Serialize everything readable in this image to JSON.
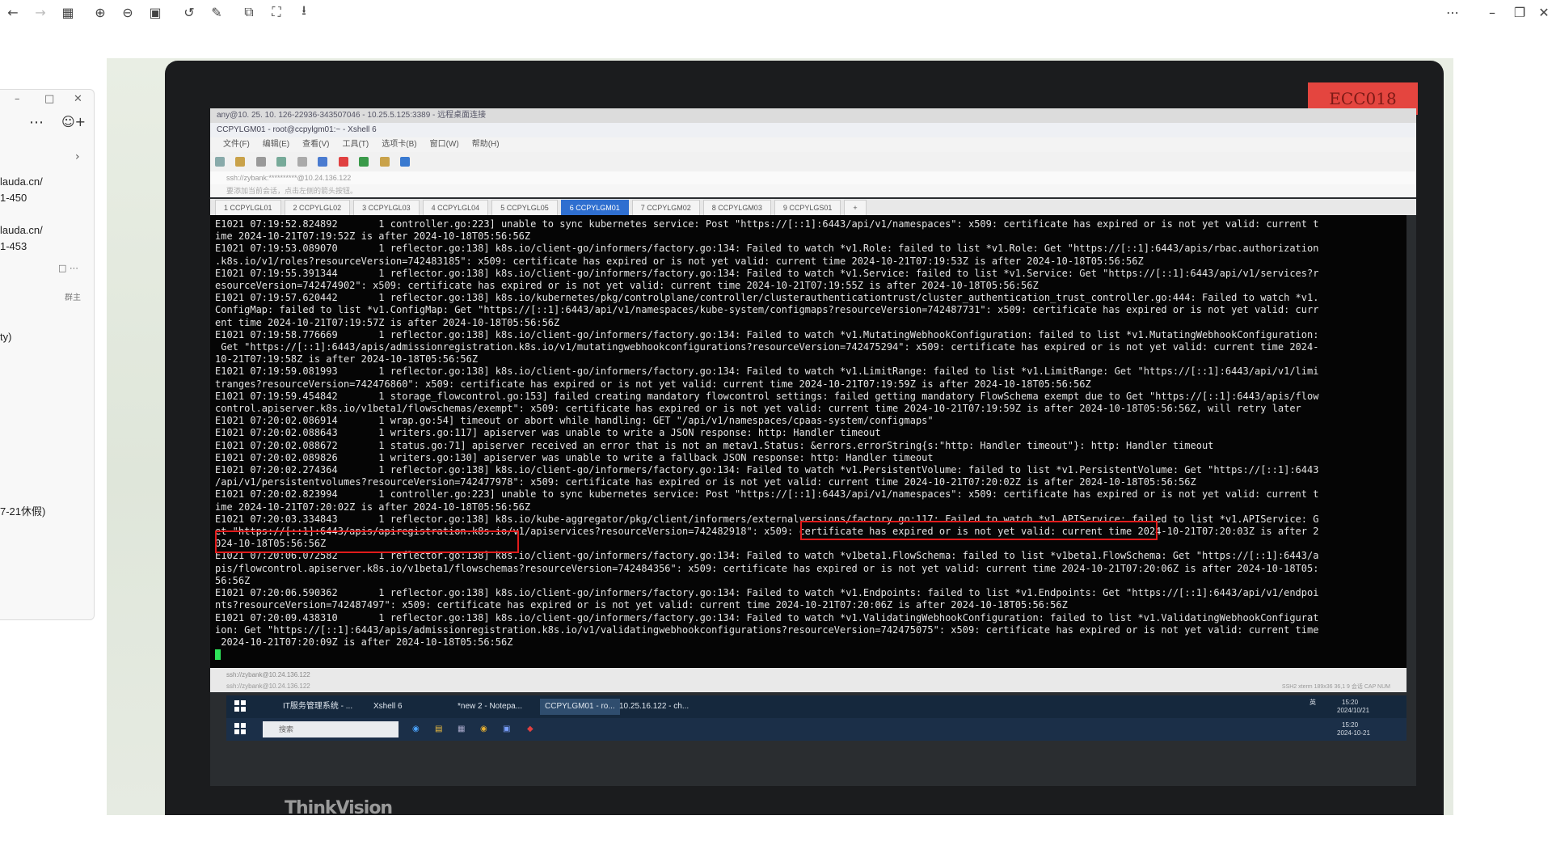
{
  "toolbar": {
    "icons": [
      "back-arrow",
      "forward-arrow",
      "grid",
      "zoom-in",
      "zoom-out",
      "fit",
      "rotate",
      "edit",
      "copy",
      "fullscreen",
      "save",
      "more",
      "minimize",
      "restore",
      "close"
    ]
  },
  "sidepanel": {
    "lines": [
      "lauda.cn/",
      "1-450",
      "lauda.cn/",
      "1-453",
      "群主",
      "ty)",
      "7-21休假)"
    ]
  },
  "photo": {
    "sticker": "ECC018",
    "brand": "ThinkVision",
    "remote_title": "any@10. 25. 10. 126-22936-343507046 - 10.25.5.125:3389 - 远程桌面连接",
    "xshell_title": "CCPYLGM01 - root@ccpylgm01:~ - Xshell 6",
    "menu": [
      "文件(F)",
      "编辑(E)",
      "查看(V)",
      "工具(T)",
      "选项卡(B)",
      "窗口(W)",
      "帮助(H)"
    ],
    "address": "ssh://zybank:**********@10.24.136.122",
    "tip": "要添加当前会话，点击左侧的箭头按钮。",
    "tabs": [
      "1 CCPYLGL01",
      "2 CCPYLGL02",
      "3 CCPYLGL03",
      "4 CCPYLGL04",
      "5 CCPYLGL05",
      "6 CCPYLGM01",
      "7 CCPYLGM02",
      "8 CCPYLGM03",
      "9 CCPYLGS01",
      "+"
    ],
    "active_tab_index": 5,
    "log": [
      "E1021 07:19:52.824892       1 controller.go:223] unable to sync kubernetes service: Post \"https://[::1]:6443/api/v1/namespaces\": x509: certificate has expired or is not yet valid: current t",
      "ime 2024-10-21T07:19:52Z is after 2024-10-18T05:56:56Z",
      "E1021 07:19:53.089070       1 reflector.go:138] k8s.io/client-go/informers/factory.go:134: Failed to watch *v1.Role: failed to list *v1.Role: Get \"https://[::1]:6443/apis/rbac.authorization",
      ".k8s.io/v1/roles?resourceVersion=742483185\": x509: certificate has expired or is not yet valid: current time 2024-10-21T07:19:53Z is after 2024-10-18T05:56:56Z",
      "E1021 07:19:55.391344       1 reflector.go:138] k8s.io/client-go/informers/factory.go:134: Failed to watch *v1.Service: failed to list *v1.Service: Get \"https://[::1]:6443/api/v1/services?r",
      "esourceVersion=742474902\": x509: certificate has expired or is not yet valid: current time 2024-10-21T07:19:55Z is after 2024-10-18T05:56:56Z",
      "E1021 07:19:57.620442       1 reflector.go:138] k8s.io/kubernetes/pkg/controlplane/controller/clusterauthenticationtrust/cluster_authentication_trust_controller.go:444: Failed to watch *v1.",
      "ConfigMap: failed to list *v1.ConfigMap: Get \"https://[::1]:6443/api/v1/namespaces/kube-system/configmaps?resourceVersion=742487731\": x509: certificate has expired or is not yet valid: curr",
      "ent time 2024-10-21T07:19:57Z is after 2024-10-18T05:56:56Z",
      "E1021 07:19:58.776669       1 reflector.go:138] k8s.io/client-go/informers/factory.go:134: Failed to watch *v1.MutatingWebhookConfiguration: failed to list *v1.MutatingWebhookConfiguration:",
      " Get \"https://[::1]:6443/apis/admissionregistration.k8s.io/v1/mutatingwebhookconfigurations?resourceVersion=742475294\": x509: certificate has expired or is not yet valid: current time 2024-",
      "10-21T07:19:58Z is after 2024-10-18T05:56:56Z",
      "E1021 07:19:59.081993       1 reflector.go:138] k8s.io/client-go/informers/factory.go:134: Failed to watch *v1.LimitRange: failed to list *v1.LimitRange: Get \"https://[::1]:6443/api/v1/limi",
      "tranges?resourceVersion=742476860\": x509: certificate has expired or is not yet valid: current time 2024-10-21T07:19:59Z is after 2024-10-18T05:56:56Z",
      "E1021 07:19:59.454842       1 storage_flowcontrol.go:153] failed creating mandatory flowcontrol settings: failed getting mandatory FlowSchema exempt due to Get \"https://[::1]:6443/apis/flow",
      "control.apiserver.k8s.io/v1beta1/flowschemas/exempt\": x509: certificate has expired or is not yet valid: current time 2024-10-21T07:19:59Z is after 2024-10-18T05:56:56Z, will retry later",
      "E1021 07:20:02.086914       1 wrap.go:54] timeout or abort while handling: GET \"/api/v1/namespaces/cpaas-system/configmaps\"",
      "E1021 07:20:02.088643       1 writers.go:117] apiserver was unable to write a JSON response: http: Handler timeout",
      "E1021 07:20:02.088672       1 status.go:71] apiserver received an error that is not an metav1.Status: &errors.errorString{s:\"http: Handler timeout\"}: http: Handler timeout",
      "E1021 07:20:02.089826       1 writers.go:130] apiserver was unable to write a fallback JSON response: http: Handler timeout",
      "E1021 07:20:02.274364       1 reflector.go:138] k8s.io/client-go/informers/factory.go:134: Failed to watch *v1.PersistentVolume: failed to list *v1.PersistentVolume: Get \"https://[::1]:6443",
      "/api/v1/persistentvolumes?resourceVersion=742477978\": x509: certificate has expired or is not yet valid: current time 2024-10-21T07:20:02Z is after 2024-10-18T05:56:56Z",
      "E1021 07:20:02.823994       1 controller.go:223] unable to sync kubernetes service: Post \"https://[::1]:6443/api/v1/namespaces\": x509: certificate has expired or is not yet valid: current t",
      "ime 2024-10-21T07:20:02Z is after 2024-10-18T05:56:56Z",
      "E1021 07:20:03.334843       1 reflector.go:138] k8s.io/kube-aggregator/pkg/client/informers/externalversions/factory.go:117: Failed to watch *v1.APIService: failed to list *v1.APIService: G",
      "et \"https://[::1]:6443/apis/apiregistration.k8s.io/v1/apiservices?resourceVersion=742482918\": x509: certificate has expired or is not yet valid: current time 2024-10-21T07:20:03Z is after 2",
      "024-10-18T05:56:56Z",
      "E1021 07:20:06.072582       1 reflector.go:138] k8s.io/client-go/informers/factory.go:134: Failed to watch *v1beta1.FlowSchema: failed to list *v1beta1.FlowSchema: Get \"https://[::1]:6443/a",
      "pis/flowcontrol.apiserver.k8s.io/v1beta1/flowschemas?resourceVersion=742484356\": x509: certificate has expired or is not yet valid: current time 2024-10-21T07:20:06Z is after 2024-10-18T05:",
      "56:56Z",
      "E1021 07:20:06.590362       1 reflector.go:138] k8s.io/client-go/informers/factory.go:134: Failed to watch *v1.Endpoints: failed to list *v1.Endpoints: Get \"https://[::1]:6443/api/v1/endpoi",
      "nts?resourceVersion=742487497\": x509: certificate has expired or is not yet valid: current time 2024-10-21T07:20:06Z is after 2024-10-18T05:56:56Z",
      "E1021 07:20:09.438310       1 reflector.go:138] k8s.io/client-go/informers/factory.go:134: Failed to watch *v1.ValidatingWebhookConfiguration: failed to list *v1.ValidatingWebhookConfigurat",
      "ion: Get \"https://[::1]:6443/apis/admissionregistration.k8s.io/v1/validatingwebhookconfigurations?resourceVersion=742475075\": x509: certificate has expired or is not yet valid: current time",
      " 2024-10-21T07:20:09Z is after 2024-10-18T05:56:56Z"
    ],
    "status_session": "ssh://zybank@10.24.136.122",
    "status_right": "SSH2   xterm   189x36   36,1   9 会话   CAP  NUM",
    "taskbar_top": [
      "IT服务管理系统 - ...",
      "Xshell 6",
      "*new 2 - Notepa...",
      "CCPYLGM01 - ro...",
      "10.25.16.122 - ch..."
    ],
    "taskbar_search": "搜索",
    "tray_lang": "英",
    "clock_time": "15:20",
    "clock_date": "2024/10/21",
    "clock_time2": "15:20",
    "clock_date2": "2024-10-21"
  }
}
